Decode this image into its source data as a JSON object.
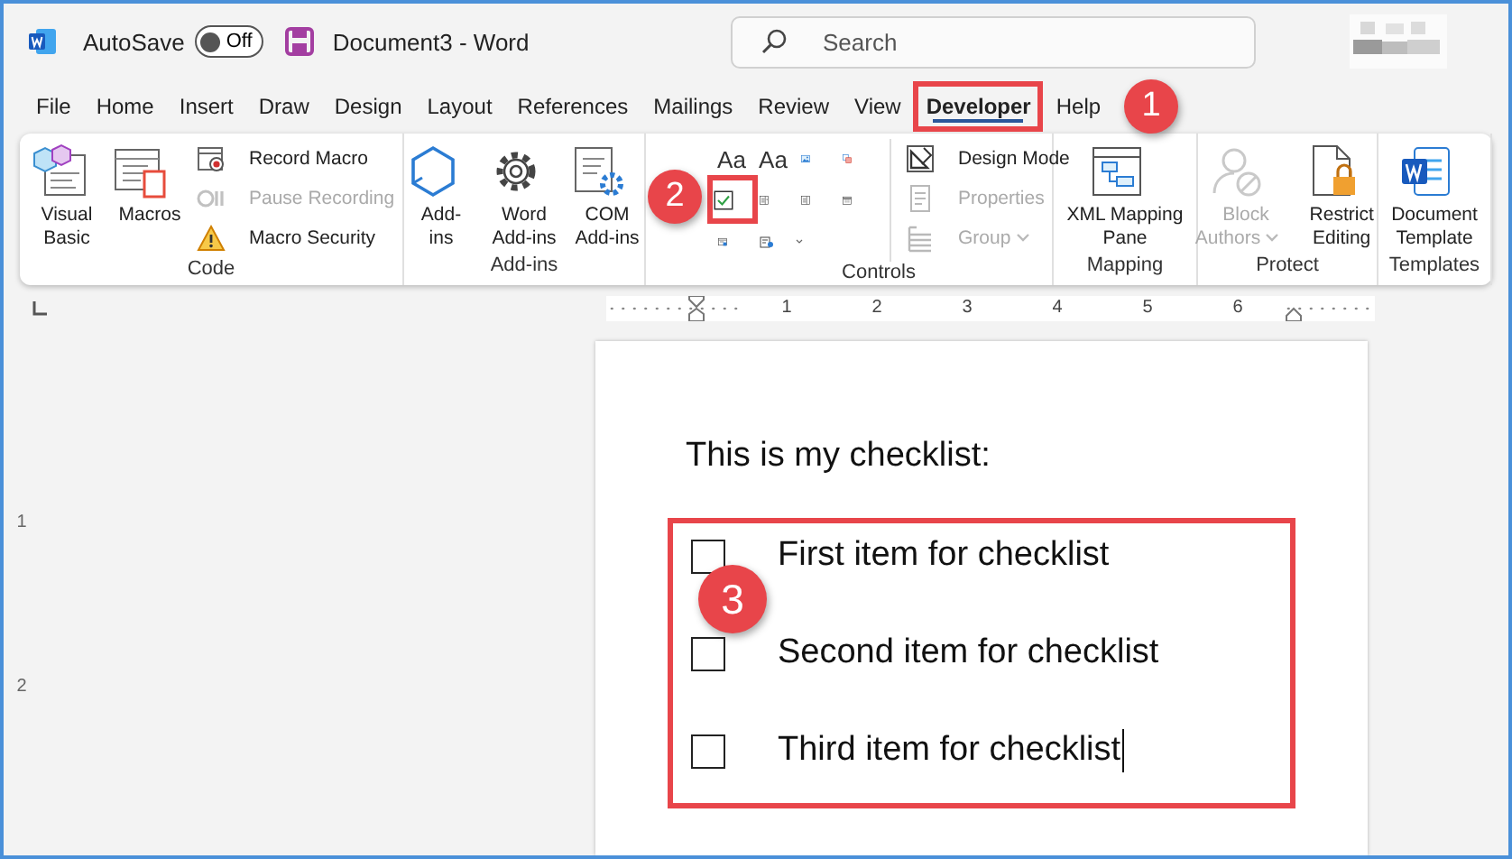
{
  "title_bar": {
    "autosave_label": "AutoSave",
    "autosave": {
      "on": false,
      "label": "Off"
    },
    "document_title": "Document3  -  Word",
    "search": {
      "placeholder": "Search"
    }
  },
  "tabs": [
    {
      "label": "File",
      "selected": false,
      "highlighted": false
    },
    {
      "label": "Home",
      "selected": false,
      "highlighted": false
    },
    {
      "label": "Insert",
      "selected": false,
      "highlighted": false
    },
    {
      "label": "Draw",
      "selected": false,
      "highlighted": false
    },
    {
      "label": "Design",
      "selected": false,
      "highlighted": false
    },
    {
      "label": "Layout",
      "selected": false,
      "highlighted": false
    },
    {
      "label": "References",
      "selected": false,
      "highlighted": false
    },
    {
      "label": "Mailings",
      "selected": false,
      "highlighted": false
    },
    {
      "label": "Review",
      "selected": false,
      "highlighted": false
    },
    {
      "label": "View",
      "selected": false,
      "highlighted": false
    },
    {
      "label": "Developer",
      "selected": true,
      "highlighted": true,
      "callout": "1"
    },
    {
      "label": "Help",
      "selected": false,
      "highlighted": false
    }
  ],
  "ribbon": {
    "groups": [
      {
        "label": "Code",
        "items": [
          {
            "kind": "large",
            "lines": [
              "Visual",
              "Basic"
            ],
            "disabled": false,
            "menu": false
          },
          {
            "kind": "large",
            "lines": [
              "Macros"
            ],
            "disabled": false,
            "menu": false
          },
          {
            "kind": "stack",
            "items": [
              {
                "label": "Record Macro",
                "disabled": false,
                "menu": false
              },
              {
                "label": "Pause Recording",
                "disabled": true,
                "menu": false
              },
              {
                "label": "Macro Security",
                "disabled": false,
                "menu": false
              }
            ]
          }
        ]
      },
      {
        "label": "Add-ins",
        "items": [
          {
            "kind": "large",
            "lines": [
              "Add-",
              "ins"
            ],
            "disabled": false,
            "menu": false
          },
          {
            "kind": "large",
            "lines": [
              "Word",
              "Add-ins"
            ],
            "disabled": false,
            "menu": false
          },
          {
            "kind": "large",
            "lines": [
              "COM",
              "Add-ins"
            ],
            "disabled": false,
            "menu": false
          }
        ]
      },
      {
        "label": "Controls",
        "items": [
          {
            "kind": "grid",
            "cells": [
              {
                "text": "Aa",
                "highlighted": false,
                "menu": false
              },
              {
                "text": "Aa",
                "highlighted": false,
                "menu": false
              },
              {
                "highlighted": false,
                "menu": false
              },
              {
                "highlighted": false,
                "menu": false
              },
              {
                "highlighted": true,
                "callout": "2",
                "menu": false
              },
              {
                "highlighted": false,
                "menu": false
              },
              {
                "highlighted": false,
                "menu": false
              },
              {
                "highlighted": false,
                "menu": false
              },
              {
                "highlighted": false,
                "menu": false
              },
              {
                "highlighted": false,
                "menu": true
              }
            ]
          },
          {
            "kind": "stack",
            "items": [
              {
                "label": "Design Mode",
                "disabled": false,
                "menu": false
              },
              {
                "label": "Properties",
                "disabled": true,
                "menu": false
              },
              {
                "label": "Group",
                "disabled": true,
                "menu": true
              }
            ]
          }
        ]
      },
      {
        "label": "Mapping",
        "items": [
          {
            "kind": "large",
            "lines": [
              "XML Mapping",
              "Pane"
            ],
            "disabled": false,
            "menu": false
          }
        ]
      },
      {
        "label": "Protect",
        "items": [
          {
            "kind": "large",
            "lines": [
              "Block",
              "Authors"
            ],
            "disabled": true,
            "menu": true
          },
          {
            "kind": "large",
            "lines": [
              "Restrict",
              "Editing"
            ],
            "disabled": false,
            "menu": false
          }
        ]
      },
      {
        "label": "Templates",
        "items": [
          {
            "kind": "large",
            "lines": [
              "Document",
              "Template"
            ],
            "disabled": false,
            "menu": false
          }
        ]
      }
    ]
  },
  "ruler": {
    "marks": [
      "1",
      "2",
      "3",
      "4",
      "5",
      "6"
    ]
  },
  "vertical_ruler": {
    "marks": [
      "1",
      "2"
    ]
  },
  "document": {
    "heading": "This is my checklist:",
    "checklist": {
      "highlighted": true,
      "callout": "3",
      "items": [
        {
          "text": "First item for checklist",
          "checked": false,
          "caret": false
        },
        {
          "text": "Second item for checklist",
          "checked": false,
          "caret": false
        },
        {
          "text": "Third item for checklist",
          "checked": false,
          "caret": true
        }
      ]
    }
  }
}
